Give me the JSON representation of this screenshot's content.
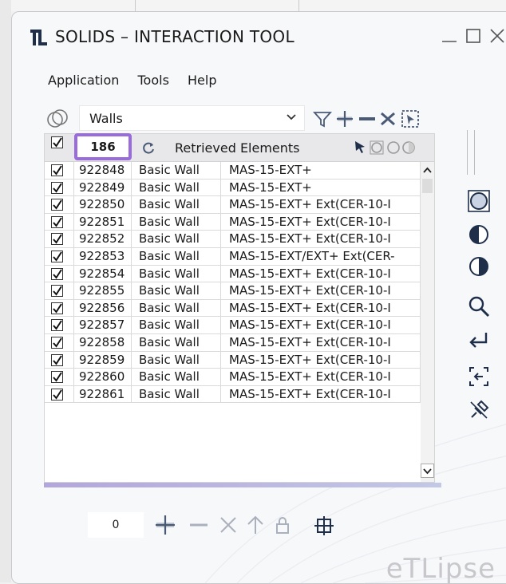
{
  "window": {
    "title": "SOLIDS – INTERACTION TOOL"
  },
  "menu": {
    "items": [
      "Application",
      "Tools",
      "Help"
    ]
  },
  "filter": {
    "category": "Walls"
  },
  "grid": {
    "count": "186",
    "header_label": "Retrieved Elements",
    "rows": [
      {
        "checked": true,
        "id": "922848",
        "category": "Basic Wall",
        "type": "MAS-15-EXT+"
      },
      {
        "checked": true,
        "id": "922849",
        "category": "Basic Wall",
        "type": "MAS-15-EXT+"
      },
      {
        "checked": true,
        "id": "922850",
        "category": "Basic Wall",
        "type": "MAS-15-EXT+ Ext(CER-10-I"
      },
      {
        "checked": true,
        "id": "922851",
        "category": "Basic Wall",
        "type": "MAS-15-EXT+ Ext(CER-10-I"
      },
      {
        "checked": true,
        "id": "922852",
        "category": "Basic Wall",
        "type": "MAS-15-EXT+ Ext(CER-10-I"
      },
      {
        "checked": true,
        "id": "922853",
        "category": "Basic Wall",
        "type": "MAS-15-EXT/EXT+ Ext(CER-"
      },
      {
        "checked": true,
        "id": "922854",
        "category": "Basic Wall",
        "type": "MAS-15-EXT+ Ext(CER-10-I"
      },
      {
        "checked": true,
        "id": "922855",
        "category": "Basic Wall",
        "type": "MAS-15-EXT+ Ext(CER-10-I"
      },
      {
        "checked": true,
        "id": "922856",
        "category": "Basic Wall",
        "type": "MAS-15-EXT+ Ext(CER-10-I"
      },
      {
        "checked": true,
        "id": "922857",
        "category": "Basic Wall",
        "type": "MAS-15-EXT+ Ext(CER-10-I"
      },
      {
        "checked": true,
        "id": "922858",
        "category": "Basic Wall",
        "type": "MAS-15-EXT+ Ext(CER-10-I"
      },
      {
        "checked": true,
        "id": "922859",
        "category": "Basic Wall",
        "type": "MAS-15-EXT+ Ext(CER-10-I"
      },
      {
        "checked": true,
        "id": "922860",
        "category": "Basic Wall",
        "type": "MAS-15-EXT+ Ext(CER-10-I"
      },
      {
        "checked": true,
        "id": "922861",
        "category": "Basic Wall",
        "type": "MAS-15-EXT+ Ext(CER-10-I"
      }
    ]
  },
  "bottom": {
    "field_value": "0"
  },
  "brand": "eTLipse",
  "colors": {
    "highlight": "#9a6bdc",
    "icon_dark": "#1f2f4a",
    "icon_mid": "#4a5a76"
  }
}
